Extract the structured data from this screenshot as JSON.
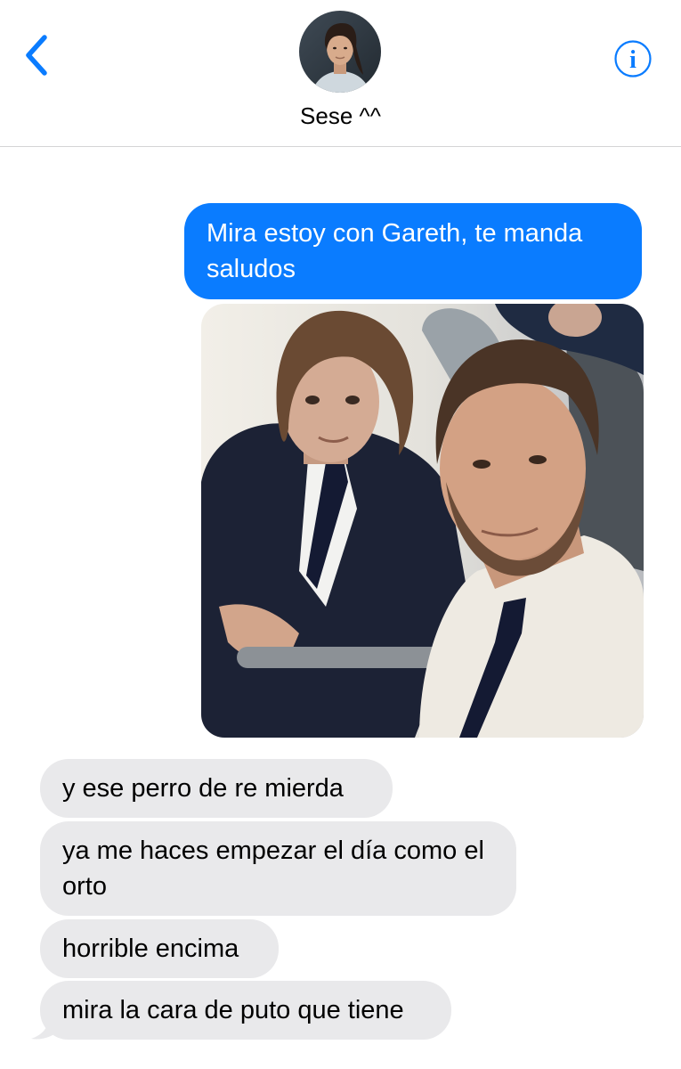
{
  "header": {
    "back_icon": "chevron-left-icon",
    "contact_name": "Sese ^^",
    "info_icon": "info-circle-icon",
    "accent_color": "#0a7cff"
  },
  "messages": [
    {
      "direction": "sent",
      "type": "text",
      "text": "Mira estoy con Gareth, te manda saludos"
    },
    {
      "direction": "sent",
      "type": "photo"
    },
    {
      "direction": "received",
      "type": "text",
      "text": "y ese perro de re mierda"
    },
    {
      "direction": "received",
      "type": "text",
      "text": "ya me haces empezar el día como el orto"
    },
    {
      "direction": "received",
      "type": "text",
      "text": "horrible encima"
    },
    {
      "direction": "received",
      "type": "text",
      "text": "mira la cara de puto que tiene"
    }
  ],
  "colors": {
    "sent_bubble": "#0a7cff",
    "received_bubble": "#e9e9eb"
  }
}
